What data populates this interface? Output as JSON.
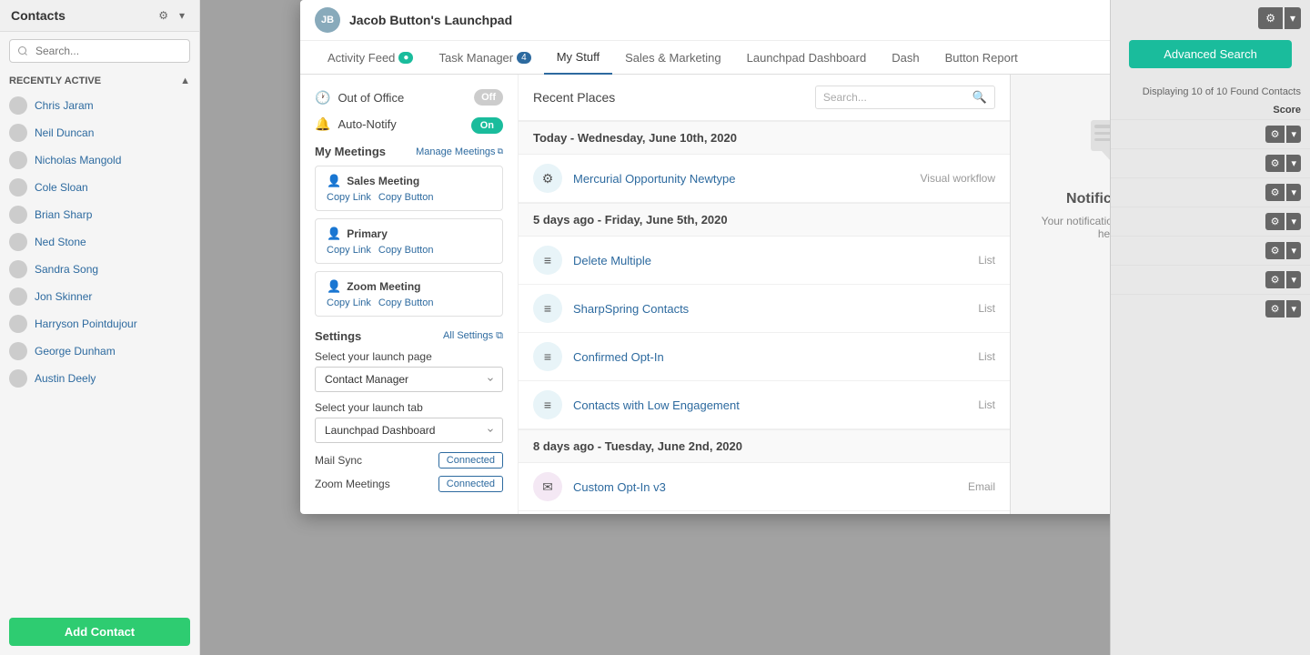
{
  "sidebar": {
    "title": "Contacts",
    "search_placeholder": "Search...",
    "recently_active_label": "RECENTLY ACTIVE",
    "contacts": [
      {
        "name": "Chris Jaram"
      },
      {
        "name": "Neil Duncan"
      },
      {
        "name": "Nicholas Mangold"
      },
      {
        "name": "Cole Sloan"
      },
      {
        "name": "Brian Sharp"
      },
      {
        "name": "Ned Stone"
      },
      {
        "name": "Sandra Song"
      },
      {
        "name": "Jon Skinner"
      },
      {
        "name": "Harryson Pointdujour"
      },
      {
        "name": "George Dunham"
      },
      {
        "name": "Austin Deely"
      }
    ],
    "add_contact_label": "Add Contact"
  },
  "modal": {
    "title": "Jacob Button's Launchpad",
    "avatar_initials": "JB",
    "close_label": "×",
    "tabs": [
      {
        "label": "Activity Feed",
        "badge": "",
        "badge_color": "teal",
        "active": false
      },
      {
        "label": "Task Manager",
        "badge": "4",
        "badge_color": "blue",
        "active": false
      },
      {
        "label": "My Stuff",
        "badge": "",
        "active": true
      },
      {
        "label": "Sales & Marketing",
        "badge": "",
        "active": false
      },
      {
        "label": "Launchpad Dashboard",
        "badge": "",
        "active": false
      },
      {
        "label": "Dash",
        "badge": "",
        "active": false
      },
      {
        "label": "Button Report",
        "badge": "",
        "active": false
      }
    ],
    "tab_add_label": "+"
  },
  "left_panel": {
    "out_of_office_label": "Out of Office",
    "out_of_office_toggle": "Off",
    "auto_notify_label": "Auto-Notify",
    "auto_notify_toggle": "On",
    "my_meetings_label": "My Meetings",
    "manage_meetings_label": "Manage Meetings",
    "meetings": [
      {
        "name": "Sales Meeting",
        "copy_link_label": "Copy Link",
        "copy_button_label": "Copy Button"
      },
      {
        "name": "Primary",
        "copy_link_label": "Copy Link",
        "copy_button_label": "Copy Button"
      },
      {
        "name": "Zoom Meeting",
        "copy_link_label": "Copy Link",
        "copy_button_label": "Copy Button"
      }
    ],
    "settings_label": "Settings",
    "all_settings_label": "All Settings",
    "launch_page_label": "Select your launch page",
    "launch_page_value": "Contact Manager",
    "launch_tab_label": "Select your launch tab",
    "launch_tab_value": "Launchpad Dashboard",
    "mail_sync_label": "Mail Sync",
    "mail_sync_status": "Connected",
    "zoom_meetings_label": "Zoom Meetings",
    "zoom_meetings_status": "Connected"
  },
  "right_panel": {
    "recent_places_title": "Recent Places",
    "search_placeholder": "Search...",
    "date_groups": [
      {
        "date_label": "Today - Wednesday, June 10th, 2020",
        "items": [
          {
            "name": "Mercurial Opportunity Newtype",
            "type": "Visual workflow",
            "icon": "workflow"
          }
        ]
      },
      {
        "date_label": "5 days ago - Friday, June 5th, 2020",
        "items": [
          {
            "name": "Delete Multiple",
            "type": "List",
            "icon": "list"
          },
          {
            "name": "SharpSpring Contacts",
            "type": "List",
            "icon": "list"
          },
          {
            "name": "Confirmed Opt-In",
            "type": "List",
            "icon": "list"
          },
          {
            "name": "Contacts with Low Engagement",
            "type": "List",
            "icon": "list"
          }
        ]
      },
      {
        "date_label": "8 days ago - Tuesday, June 2nd, 2020",
        "items": [
          {
            "name": "Custom Opt-In v3",
            "type": "Email",
            "icon": "email"
          }
        ]
      }
    ]
  },
  "notifications": {
    "title": "Notifications",
    "message": "Your notifications will appear here."
  },
  "outer_right": {
    "displaying_text": "Displaying 10 of 10 Found Contacts",
    "score_label": "Score",
    "adv_search_label": "Advanced Search",
    "rows": 7
  }
}
